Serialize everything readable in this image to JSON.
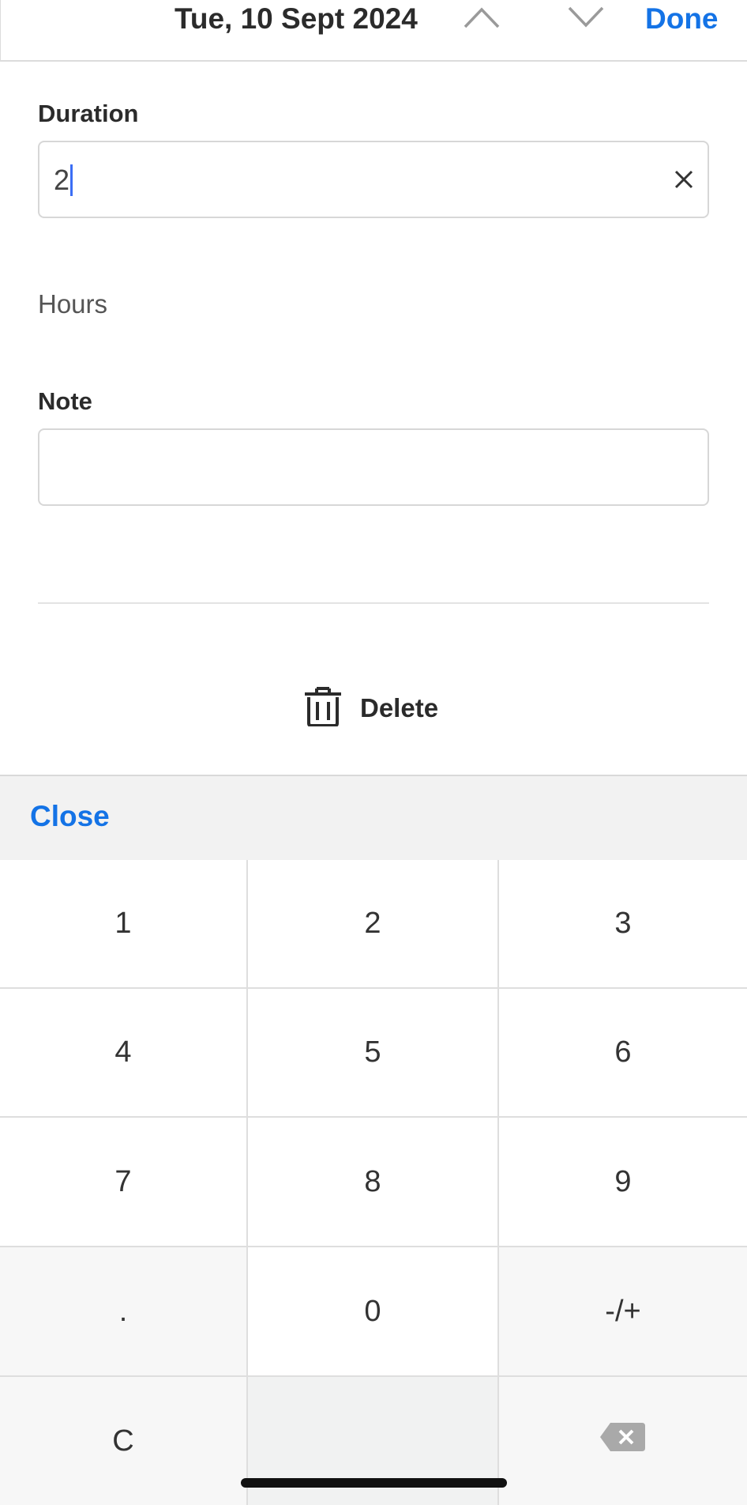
{
  "header": {
    "date": "Tue, 10 Sept 2024",
    "done_label": "Done"
  },
  "duration": {
    "label": "Duration",
    "value": "2",
    "unit": "Hours"
  },
  "note": {
    "label": "Note",
    "value": ""
  },
  "delete_label": "Delete",
  "keyboard": {
    "close_label": "Close",
    "keys": [
      "1",
      "2",
      "3",
      "4",
      "5",
      "6",
      "7",
      "8",
      "9",
      ".",
      "0",
      "-/+",
      "C"
    ]
  },
  "colors": {
    "accent": "#1473e6",
    "caret": "#3b6ef5"
  }
}
